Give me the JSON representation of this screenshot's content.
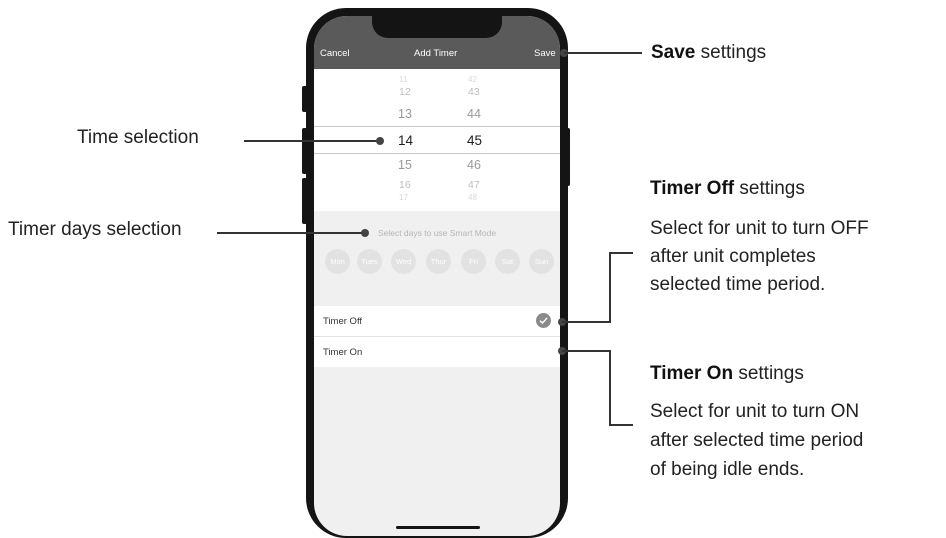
{
  "nav": {
    "cancel": "Cancel",
    "title": "Add Timer",
    "save": "Save"
  },
  "picker": {
    "hours": [
      "11",
      "12",
      "13",
      "14",
      "15",
      "16",
      "17"
    ],
    "minutes": [
      "42",
      "43",
      "44",
      "45",
      "46",
      "47",
      "48"
    ]
  },
  "days_hint": "Select days to use Smart Mode",
  "days": [
    "Mon",
    "Tues",
    "Wed",
    "Thur",
    "Fri",
    "Sat",
    "Sun"
  ],
  "options": {
    "timer_off": "Timer Off",
    "timer_on": "Timer On"
  },
  "annotations": {
    "save_bold": "Save",
    "save_rest": " settings",
    "time_selection": "Time selection",
    "days_selection": "Timer days selection",
    "timer_off_bold": "Timer Off",
    "timer_off_rest": " settings",
    "timer_off_desc": [
      "Select for unit to turn OFF",
      "after unit completes",
      "selected time period."
    ],
    "timer_on_bold": "Timer On",
    "timer_on_rest": " settings",
    "timer_on_desc": [
      "Select for unit to turn ON",
      "after  selected time period",
      "of being idle ends."
    ]
  }
}
